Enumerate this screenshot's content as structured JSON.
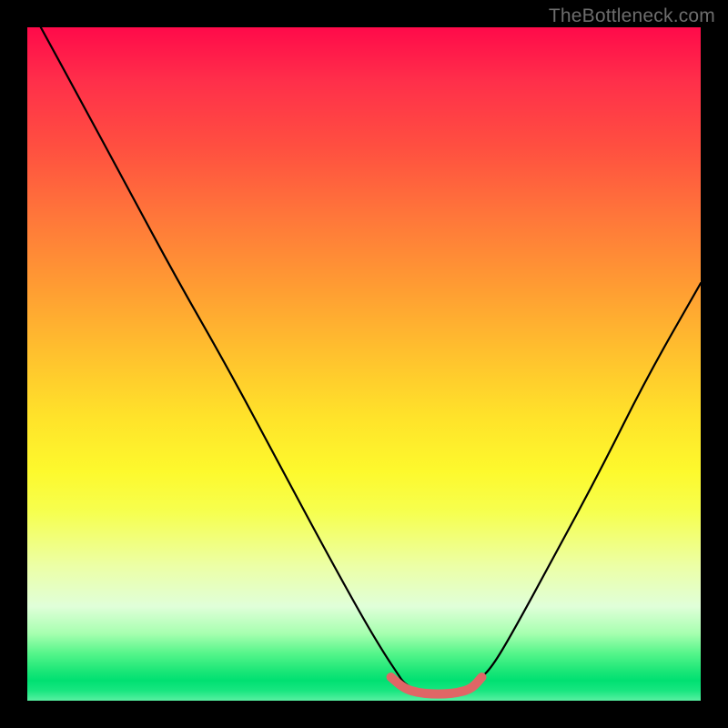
{
  "watermark": "TheBottleneck.com",
  "chart_data": {
    "type": "line",
    "title": "",
    "xlabel": "",
    "ylabel": "",
    "xlim": [
      0,
      100
    ],
    "ylim": [
      0,
      100
    ],
    "grid": false,
    "legend": false,
    "series": [
      {
        "name": "bottleneck-curve",
        "color": "#000000",
        "x": [
          2,
          8,
          15,
          22,
          30,
          38,
          45,
          50,
          53,
          55,
          56,
          58,
          60,
          62,
          64,
          66,
          67,
          69,
          72,
          78,
          85,
          92,
          100
        ],
        "y": [
          100,
          89,
          76,
          63,
          49,
          34,
          21,
          12,
          7,
          4,
          2.5,
          1.5,
          1,
          1,
          1.3,
          2,
          3,
          5,
          10,
          21,
          34,
          48,
          62
        ]
      },
      {
        "name": "optimal-range-marker",
        "color": "#e06666",
        "x": [
          54,
          56,
          58,
          60,
          62,
          64,
          66,
          67.5
        ],
        "y": [
          3.5,
          1.8,
          1.2,
          1,
          1,
          1.2,
          1.8,
          3.5
        ]
      }
    ],
    "gradient_stops": [
      {
        "pos": 0,
        "color": "#ff0a4a"
      },
      {
        "pos": 8,
        "color": "#ff2f4a"
      },
      {
        "pos": 18,
        "color": "#ff5040"
      },
      {
        "pos": 28,
        "color": "#ff763a"
      },
      {
        "pos": 38,
        "color": "#ff9a33"
      },
      {
        "pos": 48,
        "color": "#ffbf2e"
      },
      {
        "pos": 58,
        "color": "#ffe32a"
      },
      {
        "pos": 66,
        "color": "#fdf92d"
      },
      {
        "pos": 72,
        "color": "#f6ff4f"
      },
      {
        "pos": 80,
        "color": "#ecffa6"
      },
      {
        "pos": 86,
        "color": "#e0ffd9"
      },
      {
        "pos": 90,
        "color": "#a7ffb0"
      },
      {
        "pos": 93,
        "color": "#55f58a"
      },
      {
        "pos": 95.5,
        "color": "#1de778"
      },
      {
        "pos": 97,
        "color": "#00e072"
      },
      {
        "pos": 98.5,
        "color": "#18e680"
      },
      {
        "pos": 100,
        "color": "#58f0a2"
      }
    ]
  }
}
